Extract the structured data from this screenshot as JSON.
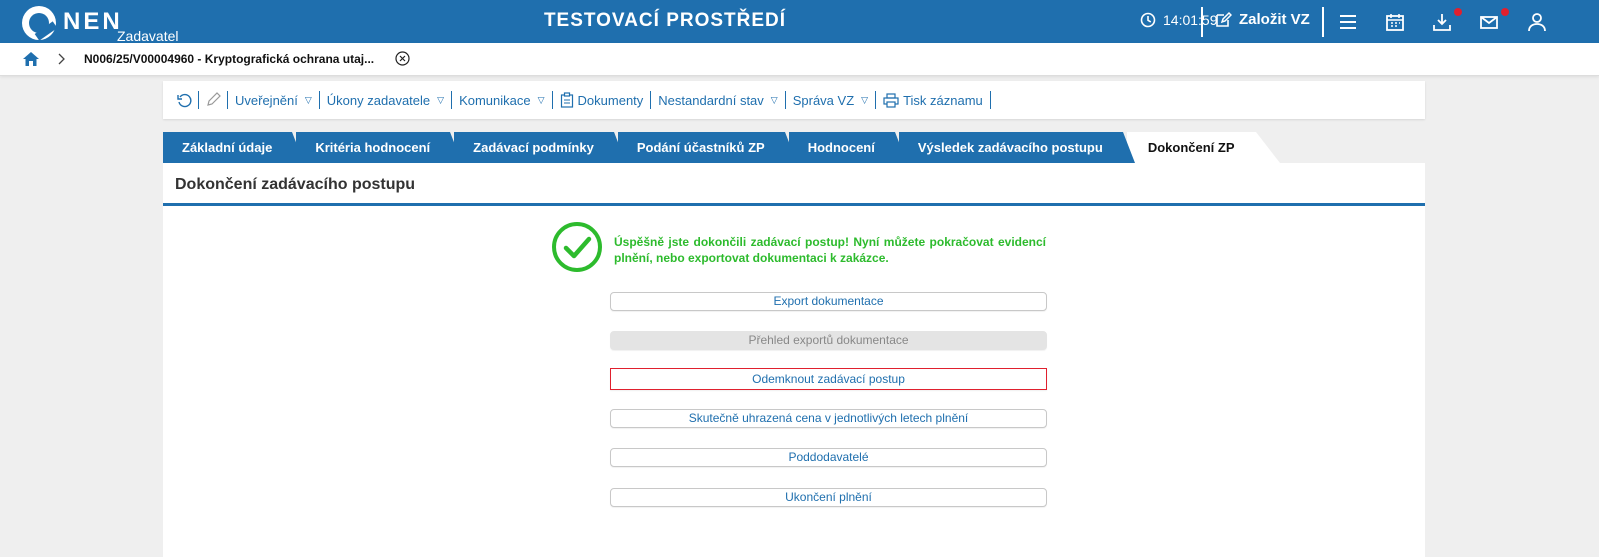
{
  "app": {
    "logo_text": "NEN",
    "logo_sub": "Zadavatel",
    "environment": "TESTOVACÍ PROSTŘEDÍ",
    "clock": "14:01:59",
    "create_label": "Založit VZ",
    "accent_color": "#1f6fae",
    "notification_color": "#e0202e"
  },
  "breadcrumb": {
    "text": "N006/25/V00004960 - Kryptografická ochrana utaj..."
  },
  "toolbar": {
    "items": [
      {
        "label": "Uveřejnění",
        "icon": ""
      },
      {
        "label": "Úkony zadavatele",
        "icon": ""
      },
      {
        "label": "Komunikace",
        "icon": ""
      },
      {
        "label": "Dokumenty",
        "icon": "clipboard-icon"
      },
      {
        "label": "Nestandardní stav",
        "icon": ""
      },
      {
        "label": "Správa VZ",
        "icon": ""
      },
      {
        "label": "Tisk záznamu",
        "icon": "printer-icon"
      }
    ],
    "dropdown_glyph": "▽"
  },
  "tabs": [
    {
      "label": "Základní údaje",
      "active": false
    },
    {
      "label": "Kritéria hodnocení",
      "active": false
    },
    {
      "label": "Zadávací podmínky",
      "active": false
    },
    {
      "label": "Podání účastníků ZP",
      "active": false
    },
    {
      "label": "Hodnocení",
      "active": false
    },
    {
      "label": "Výsledek zadávacího postupu",
      "active": false
    },
    {
      "label": "Dokončení ZP",
      "active": true
    }
  ],
  "panel": {
    "title": "Dokončení zadávacího postupu",
    "success_message": "Úspěšně jste dokončili zadávací postup! Nyní můžete pokračovat evidencí plnění, nebo exportovat dokumentaci k zakázce.",
    "success_color": "#2dbb2d",
    "buttons": [
      {
        "label": "Export dokumentace",
        "state": "normal"
      },
      {
        "label": "Přehled exportů dokumentace",
        "state": "disabled"
      },
      {
        "label": "Odemknout zadávací postup",
        "state": "focused"
      },
      {
        "label": "Skutečně uhrazená cena v jednotlivých letech plnění",
        "state": "normal"
      },
      {
        "label": "Poddodavatelé",
        "state": "normal"
      },
      {
        "label": "Ukončení plnění",
        "state": "normal"
      }
    ]
  }
}
